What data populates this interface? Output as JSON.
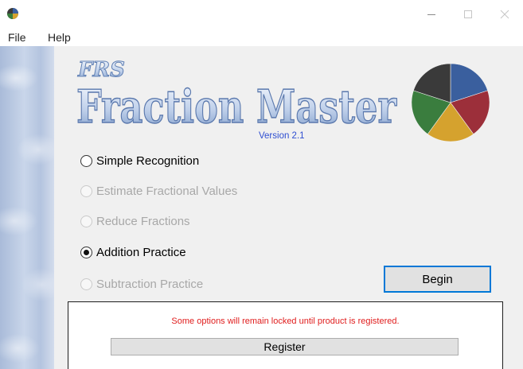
{
  "window": {
    "icon": "pie-app-icon",
    "controls": [
      "minimize-icon",
      "maximize-icon",
      "close-icon"
    ]
  },
  "menu": {
    "items": [
      {
        "label": "File"
      },
      {
        "label": "Help"
      }
    ]
  },
  "header": {
    "brand": "FRS",
    "title": "Fraction Master",
    "version": "Version 2.1",
    "pie_colors": [
      "#3a5f9e",
      "#9c2f3a",
      "#d5a22e",
      "#3a7d3e",
      "#3a3a3a"
    ]
  },
  "options": [
    {
      "label": "Simple Recognition",
      "enabled": true,
      "selected": false
    },
    {
      "label": "Estimate Fractional Values",
      "enabled": false,
      "selected": false
    },
    {
      "label": "Reduce Fractions",
      "enabled": false,
      "selected": false
    },
    {
      "label": "Addition Practice",
      "enabled": true,
      "selected": true
    },
    {
      "label": "Subtraction Practice",
      "enabled": false,
      "selected": false
    }
  ],
  "actions": {
    "begin_label": "Begin"
  },
  "registration": {
    "message": "Some options will remain locked until product is registered.",
    "button_label": "Register"
  },
  "colors": {
    "accent": "#0078d7",
    "warning_text": "#e01d1d",
    "disabled_text": "#a8a8a8"
  }
}
